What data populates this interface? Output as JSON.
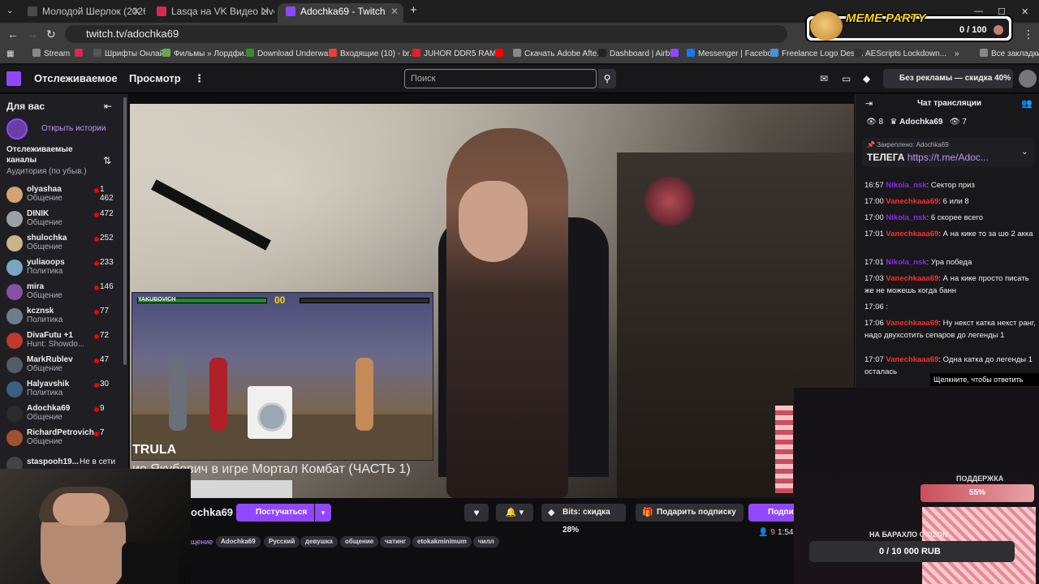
{
  "browser": {
    "tabs": [
      {
        "title": "Молодой Шерлок (2026)",
        "fav_color": "#4a4a4a"
      },
      {
        "title": "Lasqa на VK Видео Live – смотр",
        "fav_color": "#d62a4f"
      },
      {
        "title": "Adochka69 - Twitch",
        "fav_color": "#9147ff"
      }
    ],
    "new_tab": "+",
    "url": "twitch.tv/adochka69",
    "bookmarks": [
      {
        "label": "Stream",
        "color": "#888888"
      },
      {
        "label": "",
        "color": "#d62a4f"
      },
      {
        "label": "Шрифты Онлайн",
        "color": "#555555"
      },
      {
        "label": "Фильмы » Лордфи...",
        "color": "#6aa84f"
      },
      {
        "label": "Download Underwa...",
        "color": "#3c8a2e"
      },
      {
        "label": "Входящие (10) - br...",
        "color": "#e94235"
      },
      {
        "label": "JUHOR DDR5 RAM...",
        "color": "#e0202a"
      },
      {
        "label": "",
        "color": "#ff0000"
      },
      {
        "label": "Скачать Adobe Afte...",
        "color": "#888888"
      },
      {
        "label": "Dashboard | Airbit",
        "color": "#222222"
      },
      {
        "label": "",
        "color": "#9147ff"
      },
      {
        "label": "Messenger | Facebo...",
        "color": "#1877f2"
      },
      {
        "label": "Freelance Logo Desi...",
        "color": "#4a90d9"
      },
      {
        "label": "AEScripts Lockdown...",
        "color": "#333333"
      }
    ],
    "all_bookmarks": "Все закладки"
  },
  "header": {
    "following": "Отслеживаемое",
    "browse": "Просмотр",
    "search_placeholder": "Поиск",
    "ad_free": "Без рекламы — скидка 40%"
  },
  "sidebar": {
    "title": "Для вас",
    "stories": "Открыть истории",
    "followed_heading": "Отслеживаемые каналы",
    "sort_label": "Аудитория (по убыв.)",
    "channels": [
      {
        "name": "olyashaa",
        "category": "Общение",
        "viewers": "1 462",
        "color": "#d4a373"
      },
      {
        "name": "DINIK",
        "category": "Общение",
        "viewers": "472",
        "color": "#9aa0a6"
      },
      {
        "name": "shulochka",
        "category": "Общение",
        "viewers": "252",
        "color": "#c9b48a"
      },
      {
        "name": "yuliaoops",
        "category": "Политика",
        "viewers": "233",
        "color": "#7aa6c2"
      },
      {
        "name": "mira",
        "category": "Общение",
        "viewers": "146",
        "color": "#8a4fa8"
      },
      {
        "name": "kcznsk",
        "category": "Политика",
        "viewers": "77",
        "color": "#6b7f8a"
      },
      {
        "name": "DivaFutu +1",
        "category": "Hunt: Showdo...",
        "viewers": "72",
        "color": "#c0392b"
      },
      {
        "name": "MarkRublev",
        "category": "Общение",
        "viewers": "47",
        "color": "#555c63"
      },
      {
        "name": "Halyavshik",
        "category": "Политика",
        "viewers": "30",
        "color": "#3a5f80"
      },
      {
        "name": "Adochka69",
        "category": "Общение",
        "viewers": "9",
        "color": "#2b2b2b"
      },
      {
        "name": "RichardPetrovich",
        "category": "Общение",
        "viewers": "7",
        "color": "#a0522d"
      }
    ],
    "offline_channel": {
      "name": "staspooh19...",
      "status": "Не в сети"
    }
  },
  "video": {
    "game_player": "YAKUBOVICH",
    "game_timer": "00",
    "game_text": "TRULA",
    "caption": "ие Якубович в игре Мортал Комбат (ЧАСТЬ 1)"
  },
  "channel": {
    "name": "ochka69",
    "slap_button": "Постучаться",
    "bits_button": "Bits: скидка 28%",
    "gift_button": "Подарить подписку",
    "subscribe_button": "Подпи",
    "viewers": "9",
    "uptime": "1:54",
    "category": "щение",
    "tags": [
      "Adochka69",
      "Русский",
      "девушка",
      "общение",
      "чатинг",
      "etokakminimum",
      "чилл"
    ]
  },
  "chat": {
    "title": "Чат трансляции",
    "stats_views": "8",
    "stats_channel": "Adochka69",
    "stats_watch": "7",
    "pinned_label": "Закреплено:",
    "pinned_author": "Adochka69",
    "pinned_prefix": "ТЕЛЕГА",
    "pinned_link": "https://t.me/Adoc...",
    "messages": [
      {
        "time": "16:57",
        "user": "Nikola_nsk",
        "cls": "u1",
        "text": ": Сектор приз"
      },
      {
        "time": "17:00",
        "user": "Vanechkaaa69",
        "cls": "u2",
        "text": ": 6 или 8"
      },
      {
        "time": "17:00",
        "user": "Nikola_nsk",
        "cls": "u1",
        "text": ": 6 скорее всего"
      },
      {
        "time": "17:01",
        "user": "Vanechkaaa69",
        "cls": "u2",
        "text": ": А на кике то за шо 2 акка"
      },
      {
        "time": "17:01",
        "user": "Nikola_nsk",
        "cls": "u1",
        "text": ": Ура победа"
      },
      {
        "time": "17:03",
        "user": "Vanechkaaa69",
        "cls": "u2",
        "text": ": А на кике просто писать же не можешь когда банн"
      },
      {
        "time": "17:06",
        "user": "",
        "cls": "u3",
        "text": ":"
      },
      {
        "time": "17:06",
        "user": "Vanechkaaa69",
        "cls": "u2",
        "text": ": Ну некст катка некст ранг, надо двухсотить сепаров до легенды 1"
      },
      {
        "time": "17:07",
        "user": "Vanechkaaa69",
        "cls": "u2",
        "text": ": Одна катка до легенды 1 осталась"
      }
    ],
    "reply_tip": "Щелкните, чтобы ответить"
  },
  "overlays": {
    "meme_title": "MEME PARTY",
    "meme_count": "0 / 100",
    "support_title": "ПОДДЕРЖКА",
    "support_pct": "55%",
    "ozon_title": "НА БАРАХЛО С OZON",
    "ozon_value": "0 / 10 000 RUB"
  },
  "colors": {
    "accent": "#9147ff",
    "live": "#eb0400"
  }
}
